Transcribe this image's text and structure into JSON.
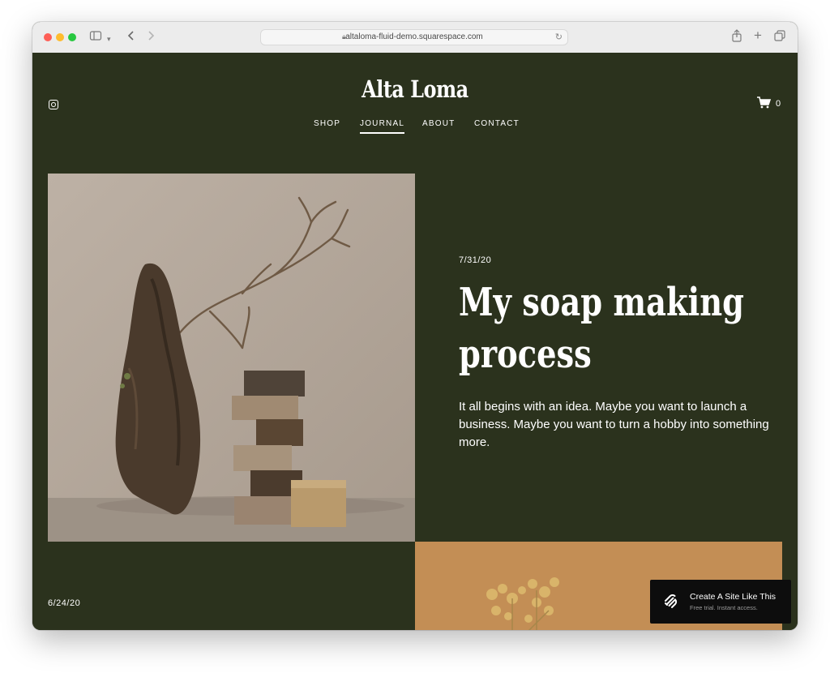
{
  "browser": {
    "url": "altaloma-fluid-demo.squarespace.com"
  },
  "site": {
    "logo": "Alta Loma",
    "cart_count": "0",
    "nav": [
      {
        "label": "SHOP"
      },
      {
        "label": "JOURNAL"
      },
      {
        "label": "ABOUT"
      },
      {
        "label": "CONTACT"
      }
    ],
    "active_nav": "JOURNAL"
  },
  "posts": [
    {
      "date": "7/31/20",
      "title": "My soap making process",
      "excerpt": "It all begins with an idea. Maybe you want to launch a business. Maybe you want to turn a hobby into something more."
    },
    {
      "date": "6/24/20"
    }
  ],
  "badge": {
    "title": "Create A Site Like This",
    "subtitle": "Free trial. Instant access."
  },
  "colors": {
    "background": "#2b321d",
    "text": "#ffffff",
    "badge_bg": "#0d0d0d"
  }
}
